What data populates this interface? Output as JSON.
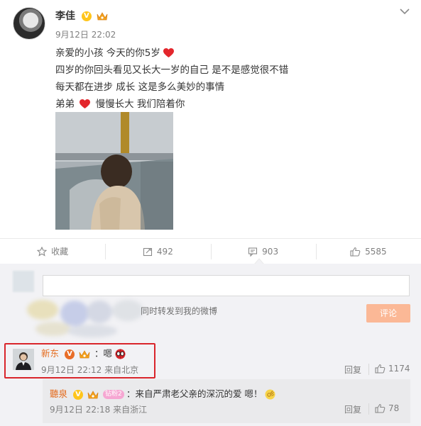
{
  "post": {
    "author": "李佳",
    "time": "9月12日 22:02",
    "lines": [
      "亲爱的小孩 今天的你5岁",
      "四岁的你回头看见又长大一岁的自己 是不是感觉很不错",
      "每天都在进步 成长 这是多么美妙的事情",
      [
        "弟弟",
        "慢慢长大 我们陪着你"
      ]
    ]
  },
  "actions": {
    "favorite_label": "收藏",
    "forward_count": "492",
    "comment_count": "903",
    "like_count": "5585"
  },
  "composer": {
    "forward_option": "同时转发到我的微博",
    "submit_label": "评论"
  },
  "comment": {
    "author": "新东",
    "text": "：嗯",
    "time": "9月12日 22:12 来自北京",
    "reply_label": "回复",
    "like_count": "1174"
  },
  "reply": {
    "author": "聽泉",
    "level": "钻粉2",
    "text": "：来自严肃老父亲的深沉的爱 嗯！",
    "time": "9月12日 22:18 来自浙江",
    "reply_label": "回复",
    "like_count": "78"
  },
  "colors": {
    "accent": "#e46a1c",
    "highlight_box": "#d9252b",
    "submit_button": "#fbb896",
    "heart": "#e3262c",
    "verified_badge": "#ffc51b"
  }
}
